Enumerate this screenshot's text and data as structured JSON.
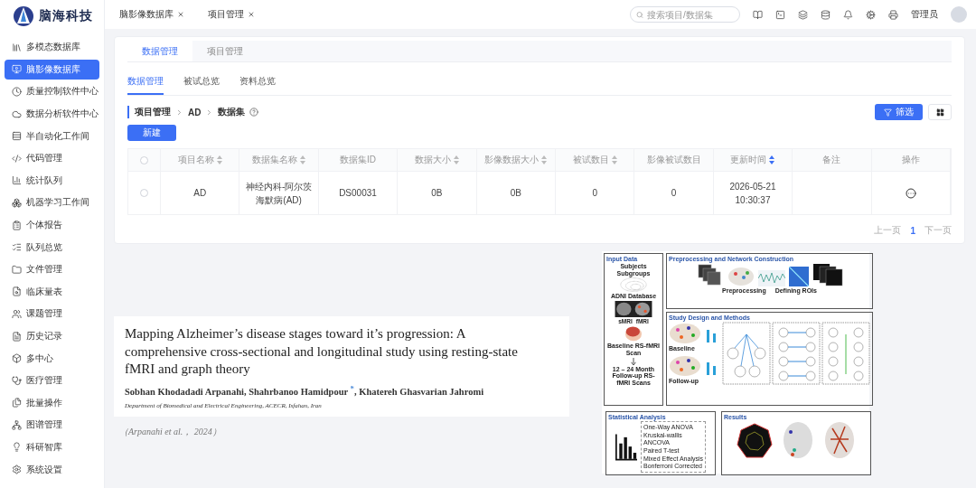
{
  "logo": {
    "name": "脑海科技"
  },
  "sidebar": {
    "items": [
      {
        "label": "多模态数据库",
        "selected": false
      },
      {
        "label": "脑影像数据库",
        "selected": true
      },
      {
        "label": "质量控制软件中心",
        "selected": false
      },
      {
        "label": "数据分析软件中心",
        "selected": false
      },
      {
        "label": "半自动化工作间",
        "selected": false
      },
      {
        "label": "代码管理",
        "selected": false
      },
      {
        "label": "统计队列",
        "selected": false
      },
      {
        "label": "机器学习工作间",
        "selected": false
      },
      {
        "label": "个体报告",
        "selected": false
      },
      {
        "label": "队列总览",
        "selected": false
      },
      {
        "label": "文件管理",
        "selected": false
      },
      {
        "label": "临床量表",
        "selected": false
      },
      {
        "label": "课题管理",
        "selected": false
      },
      {
        "label": "历史记录",
        "selected": false
      },
      {
        "label": "多中心",
        "selected": false
      },
      {
        "label": "医疗管理",
        "selected": false
      },
      {
        "label": "批量操作",
        "selected": false
      },
      {
        "label": "图谱管理",
        "selected": false
      },
      {
        "label": "科研智库",
        "selected": false
      },
      {
        "label": "系统设置",
        "selected": false
      }
    ]
  },
  "open_tabs": [
    {
      "label": "脑影像数据库"
    },
    {
      "label": "项目管理"
    }
  ],
  "search": {
    "placeholder": "搜索项目/数据集"
  },
  "user": {
    "name": "管理员"
  },
  "page_tabs": [
    {
      "label": "数据管理",
      "selected": true
    },
    {
      "label": "项目管理",
      "selected": false
    }
  ],
  "sub_tabs": [
    {
      "label": "数据管理",
      "selected": true
    },
    {
      "label": "被试总览",
      "selected": false
    },
    {
      "label": "资料总览",
      "selected": false
    }
  ],
  "breadcrumb": [
    "项目管理",
    "AD",
    "数据集"
  ],
  "buttons": {
    "new": "新建",
    "filter": "筛选"
  },
  "table": {
    "all_checked": false,
    "columns": [
      {
        "label": "项目名称",
        "kind": "data",
        "sortable": true,
        "sorted": false
      },
      {
        "label": "数据集名称",
        "kind": "data",
        "sortable": true,
        "sorted": false
      },
      {
        "label": "数据集ID",
        "kind": "data",
        "sortable": false,
        "sorted": false
      },
      {
        "label": "数据大小",
        "kind": "data",
        "sortable": true,
        "sorted": false
      },
      {
        "label": "影像数据大小",
        "kind": "data",
        "sortable": true,
        "sorted": false
      },
      {
        "label": "被试数目",
        "kind": "data",
        "sortable": true,
        "sorted": false
      },
      {
        "label": "影像被试数目",
        "kind": "data",
        "sortable": false,
        "sorted": false
      },
      {
        "label": "更新时间",
        "kind": "data",
        "sortable": true,
        "sorted": true
      },
      {
        "label": "备注",
        "kind": "note",
        "sortable": false,
        "sorted": false
      },
      {
        "label": "操作",
        "kind": "action",
        "sortable": false,
        "sorted": false
      }
    ],
    "rows": [
      {
        "checked": false,
        "cells": [
          "AD",
          "神经内科-阿尔茨海默病(AD)",
          "DS00031",
          "0B",
          "0B",
          "0",
          "0",
          "2026-05-21 10:30:37"
        ]
      }
    ]
  },
  "pagination": {
    "prev": "上一页",
    "pages": [
      {
        "label": "1",
        "selected": true
      }
    ],
    "next": "下一页"
  },
  "paper": {
    "title": "Mapping Alzheimer’s disease stages toward it’s progression: A comprehensive cross-sectional and longitudinal study using resting-state fMRI and graph theory",
    "authors": "Sobhan Khodadadi Arpanahi, Shahrbanoo Hamidpour $^{*}$, Khatereh Ghasvarian Jahromi",
    "affiliation": "Department of Biomedical and Electrical Engineering, ACECR, Isfahan, Iran",
    "citation": "（Arpanahi et al.， 2024）"
  },
  "figure": {
    "input": {
      "title": "Input Data",
      "subtitle": "Subjects Subgroups",
      "database": "ADNI Database",
      "modalities": [
        "sMRI",
        "fMRI"
      ],
      "baseline": "Baseline RS-fMRI Scan",
      "followup": "12 – 24 Month Follow-up RS-fMRI Scans"
    },
    "preprocessing": {
      "title": "Preprocessing and Network Construction",
      "steps": [
        "Preprocessing",
        "Defining ROIs"
      ]
    },
    "design": {
      "title": "Study Design and Methods",
      "sessions": [
        "Baseline",
        "Follow-up"
      ]
    },
    "stats": {
      "title": "Statistical Analysis",
      "methods": [
        "One-Way ANOVA",
        "Kruskal-wallis",
        "ANCOVA",
        "Paired T-test",
        "Mixed Effect Analysis",
        "Bonferroni Corrected"
      ]
    },
    "results": {
      "title": "Results"
    }
  }
}
